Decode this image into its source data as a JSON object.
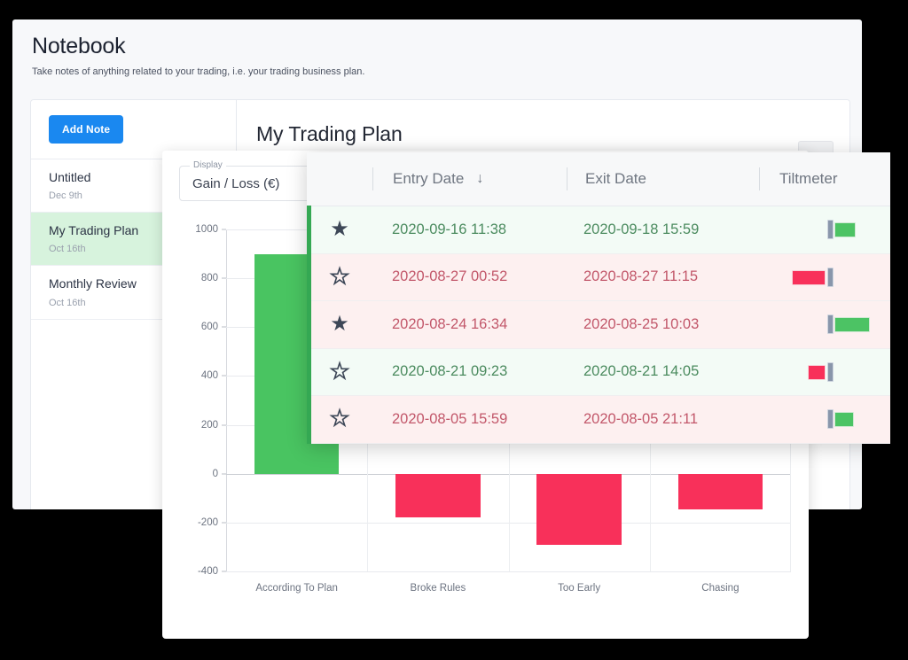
{
  "notebook": {
    "title": "Notebook",
    "subtitle": "Take notes of anything related to your trading, i.e. your trading business plan.",
    "add_note_label": "Add Note",
    "notes": [
      {
        "name": "Untitled",
        "date": "Dec 9th",
        "active": false
      },
      {
        "name": "My Trading Plan",
        "date": "Oct 16th",
        "active": true
      },
      {
        "name": "Monthly Review",
        "date": "Oct 16th",
        "active": false
      }
    ],
    "open_note_title": "My Trading Plan"
  },
  "chart_panel": {
    "display_label": "Display",
    "display_value": "Gain / Loss (€)"
  },
  "chart_data": {
    "type": "bar",
    "title": "",
    "xlabel": "",
    "ylabel": "Gain / Loss (€)",
    "categories": [
      "According To Plan",
      "Broke Rules",
      "Too Early",
      "Chasing"
    ],
    "values": [
      900,
      -180,
      -290,
      -145
    ],
    "ylim": [
      -400,
      1000
    ],
    "yticks": [
      1000,
      800,
      600,
      400,
      200,
      0,
      -200,
      -400
    ],
    "grid": true,
    "legend": "none",
    "colors": {
      "positive": "#49c461",
      "negative": "#f8305a"
    }
  },
  "trades_table": {
    "columns": [
      "",
      "Entry Date",
      "Exit Date",
      "Tiltmeter"
    ],
    "sort_column": "Entry Date",
    "sort_direction_icon": "↓",
    "rows": [
      {
        "starred": true,
        "star_icon": "★",
        "result": "win",
        "entry_date": "2020-09-16 11:38",
        "exit_date": "2020-09-18 15:59",
        "tilt_value": 24,
        "tilt_side": "positive"
      },
      {
        "starred": false,
        "star_icon": "★",
        "result": "loss",
        "entry_date": "2020-08-27 00:52",
        "exit_date": "2020-08-27 11:15",
        "tilt_value": 38,
        "tilt_side": "negative"
      },
      {
        "starred": true,
        "star_icon": "★",
        "result": "loss",
        "entry_date": "2020-08-24 16:34",
        "exit_date": "2020-08-25 10:03",
        "tilt_value": 40,
        "tilt_side": "positive"
      },
      {
        "starred": false,
        "star_icon": "★",
        "result": "win",
        "entry_date": "2020-08-21 09:23",
        "exit_date": "2020-08-21 14:05",
        "tilt_value": 20,
        "tilt_side": "negative"
      },
      {
        "starred": false,
        "star_icon": "★",
        "result": "loss",
        "entry_date": "2020-08-05 15:59",
        "exit_date": "2020-08-05 21:11",
        "tilt_value": 22,
        "tilt_side": "positive"
      }
    ]
  },
  "colors": {
    "accent_blue": "#1a88f0",
    "win_green": "#49c461",
    "loss_red": "#f8305a",
    "active_row": "#d7f3dd",
    "page_background": "#000000"
  }
}
